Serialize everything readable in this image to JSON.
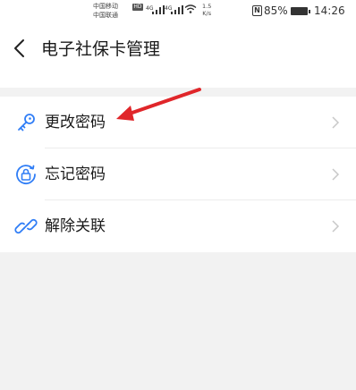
{
  "status_bar": {
    "carrier_1": "中国移动",
    "carrier_2": "中国联通",
    "hd_badge": "HD",
    "network_1": "4G",
    "network_2": "4G",
    "speed_value": "1.5",
    "speed_unit": "K/s",
    "battery_percent": "85%",
    "time": "14:26",
    "nfc_label": "N"
  },
  "nav": {
    "title": "电子社保卡管理"
  },
  "menu": {
    "items": [
      {
        "label": "更改密码",
        "icon": "key-icon"
      },
      {
        "label": "忘记密码",
        "icon": "unlock-icon"
      },
      {
        "label": "解除关联",
        "icon": "link-icon"
      }
    ]
  },
  "colors": {
    "accent": "#2f7df6",
    "annotation_arrow": "#e0262a",
    "page_background": "#f2f2f2"
  }
}
